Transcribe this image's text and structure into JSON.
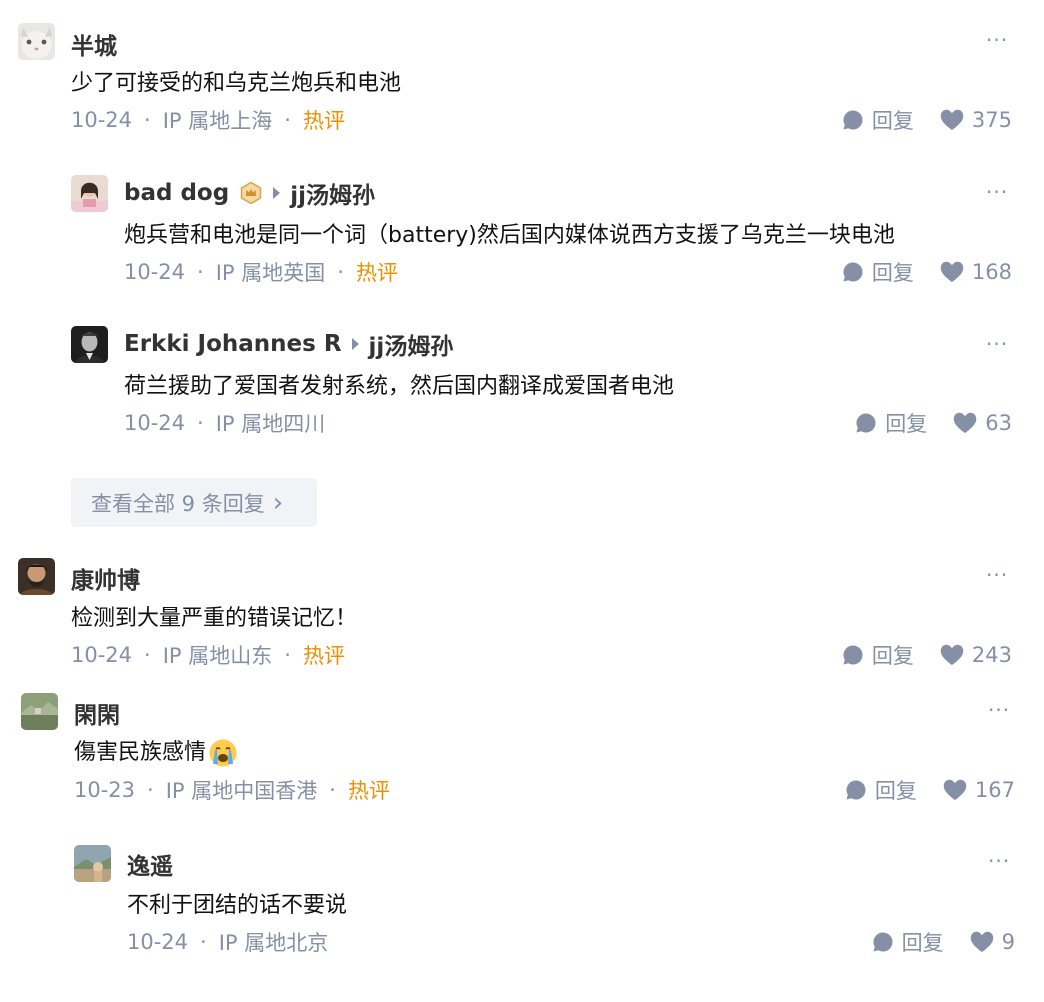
{
  "comments": [
    {
      "author": "半城",
      "content": "少了可接受的和乌克兰炮兵和电池",
      "date": "10-24",
      "location": "IP 属地上海",
      "hot": "热评",
      "reply_label": "回复",
      "likes": "375",
      "more": "···"
    },
    {
      "author": "bad dog",
      "reply_to": "jj汤姆孙",
      "content": "炮兵营和电池是同一个词（battery)然后国内媒体说西方支援了乌克兰一块电池",
      "date": "10-24",
      "location": "IP 属地英国",
      "hot": "热评",
      "reply_label": "回复",
      "likes": "168",
      "more": "···"
    },
    {
      "author": "Erkki Johannes R",
      "reply_to": "jj汤姆孙",
      "content": "荷兰援助了爱国者发射系统，然后国内翻译成爱国者电池",
      "date": "10-24",
      "location": "IP 属地四川",
      "reply_label": "回复",
      "likes": "63",
      "more": "···"
    },
    {
      "author": "康帅博",
      "content": "检测到大量严重的错误记忆！",
      "date": "10-24",
      "location": "IP 属地山东",
      "hot": "热评",
      "reply_label": "回复",
      "likes": "243",
      "more": "···"
    },
    {
      "author": "閑閑",
      "content": "傷害民族感情",
      "date": "10-23",
      "location": "IP 属地中国香港",
      "hot": "热评",
      "reply_label": "回复",
      "likes": "167",
      "more": "···"
    },
    {
      "author": "逸遥",
      "content": "不利于团结的话不要说",
      "date": "10-24",
      "location": "IP 属地北京",
      "reply_label": "回复",
      "likes": "9",
      "more": "···"
    }
  ],
  "view_all": {
    "label": "查看全部 9 条回复",
    "chevron": "›"
  },
  "colors": {
    "meta_gray": "#8590a6",
    "hot_orange": "#f09000",
    "view_all_bg": "#f1f3f6"
  },
  "icons": {
    "reply": "chat-bubble-icon",
    "like": "heart-icon",
    "badge": "crown-badge-icon",
    "emoji": "crying-face-emoji"
  }
}
